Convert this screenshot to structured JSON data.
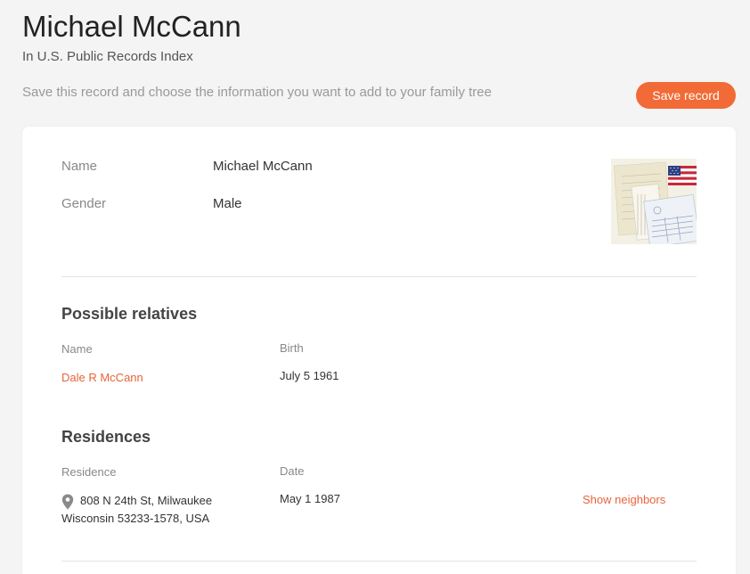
{
  "header": {
    "title": "Michael McCann",
    "subtitle": "In U.S. Public Records Index",
    "instructions": "Save this record and choose the information you want to add to your family tree",
    "save_label": "Save record"
  },
  "record": {
    "fields": [
      {
        "label": "Name",
        "value": "Michael McCann"
      },
      {
        "label": "Gender",
        "value": "Male"
      }
    ],
    "thumbnail_icon": "voter-records-flag-icon"
  },
  "relatives": {
    "title": "Possible relatives",
    "col_name": "Name",
    "col_birth": "Birth",
    "rows": [
      {
        "name": "Dale R McCann",
        "birth": "July 5 1961"
      }
    ]
  },
  "residences": {
    "title": "Residences",
    "col_residence": "Residence",
    "col_date": "Date",
    "rows": [
      {
        "line1": "808 N 24th St, Milwaukee",
        "line2": "Wisconsin 53233-1578, USA",
        "date": "May 1 1987",
        "action": "Show neighbors",
        "icon": "map-pin-icon"
      }
    ]
  },
  "colors": {
    "accent": "#f26a35",
    "link": "#e8643a"
  }
}
